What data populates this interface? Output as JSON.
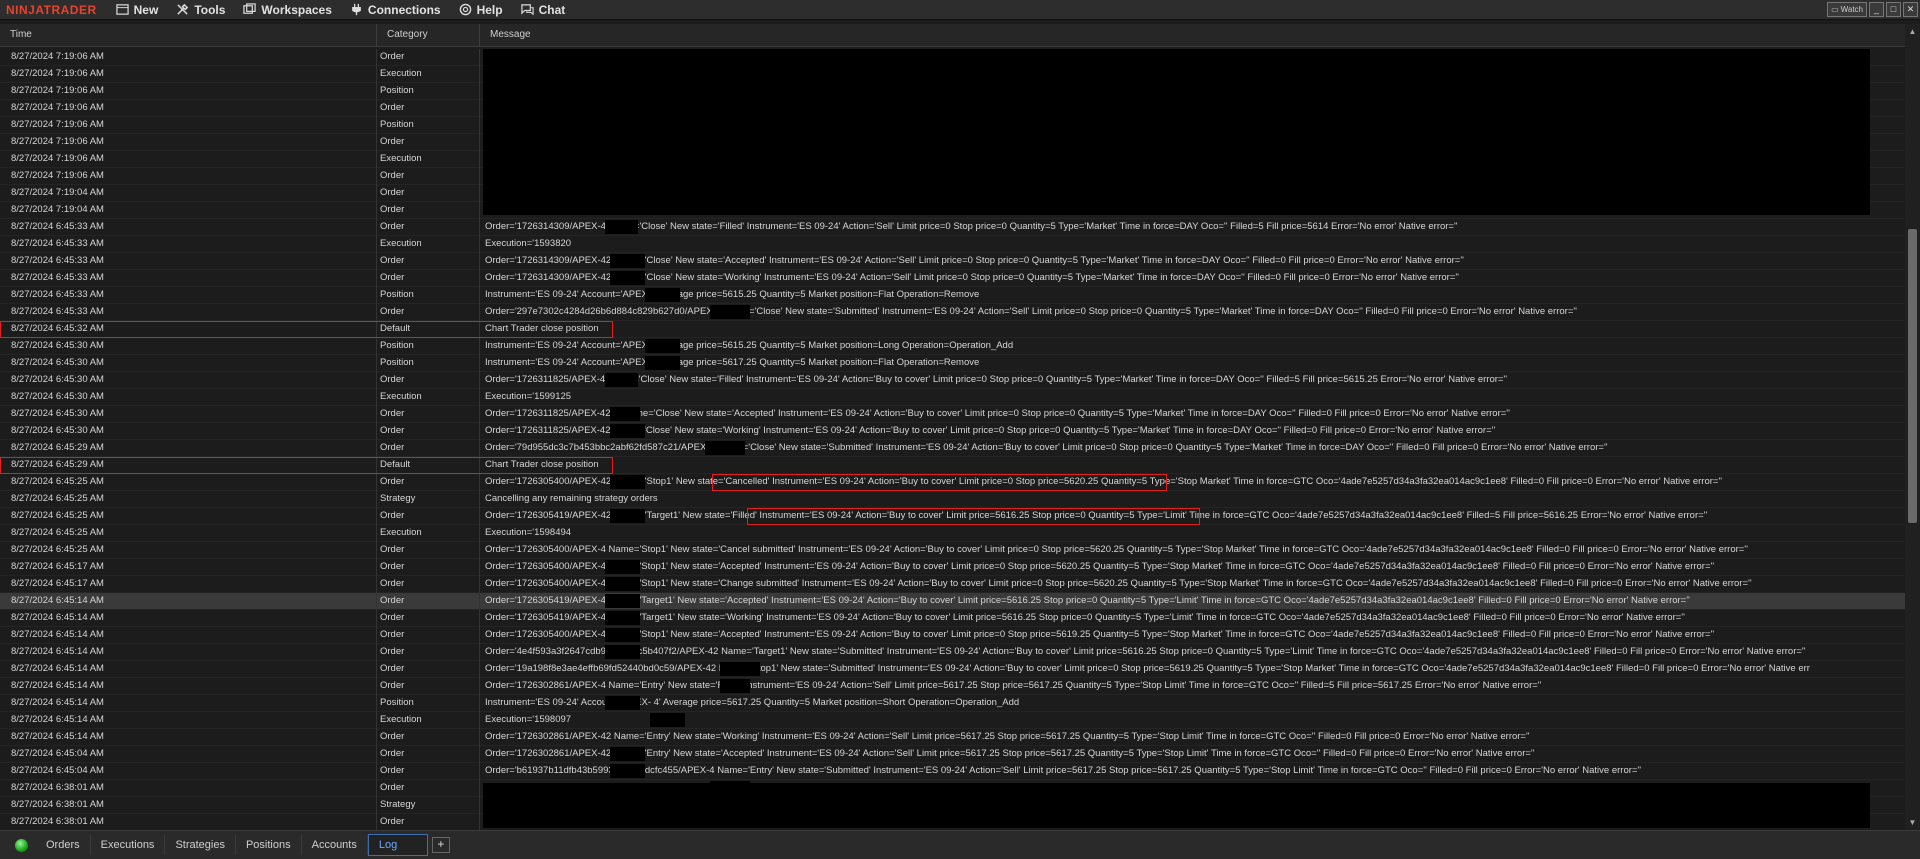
{
  "app": {
    "logo": "NINJATRADER"
  },
  "menu": [
    {
      "label": "New",
      "icon": "new-icon"
    },
    {
      "label": "Tools",
      "icon": "tools-icon"
    },
    {
      "label": "Workspaces",
      "icon": "workspaces-icon"
    },
    {
      "label": "Connections",
      "icon": "connections-icon"
    },
    {
      "label": "Help",
      "icon": "help-icon"
    },
    {
      "label": "Chat",
      "icon": "chat-icon"
    }
  ],
  "window": {
    "watch_label": "Watch"
  },
  "columns": {
    "time": "Time",
    "category": "Category",
    "message": "Message"
  },
  "rows": [
    {
      "time": "8/27/2024 7:19:06 AM",
      "category": "Order",
      "message": ""
    },
    {
      "time": "8/27/2024 7:19:06 AM",
      "category": "Execution",
      "message": ""
    },
    {
      "time": "8/27/2024 7:19:06 AM",
      "category": "Position",
      "message": ""
    },
    {
      "time": "8/27/2024 7:19:06 AM",
      "category": "Order",
      "message": ""
    },
    {
      "time": "8/27/2024 7:19:06 AM",
      "category": "Position",
      "message": ""
    },
    {
      "time": "8/27/2024 7:19:06 AM",
      "category": "Order",
      "message": ""
    },
    {
      "time": "8/27/2024 7:19:06 AM",
      "category": "Execution",
      "message": ""
    },
    {
      "time": "8/27/2024 7:19:06 AM",
      "category": "Order",
      "message": ""
    },
    {
      "time": "8/27/2024 7:19:04 AM",
      "category": "Order",
      "message": ""
    },
    {
      "time": "8/27/2024 7:19:04 AM",
      "category": "Order",
      "message": ""
    },
    {
      "time": "8/27/2024 6:45:33 AM",
      "category": "Order",
      "message": "Order='1726314309/APEX-4               Name='Close' New state='Filled' Instrument='ES 09-24' Action='Sell' Limit price=0 Stop price=0 Quantity=5 Type='Market' Time in force=DAY Oco='' Filled=5 Fill price=5614 Error='No error' Native error=''"
    },
    {
      "time": "8/27/2024 6:45:33 AM",
      "category": "Execution",
      "message": "Execution='1593820"
    },
    {
      "time": "8/27/2024 6:45:33 AM",
      "category": "Order",
      "message": "Order='1726314309/APEX-42              Name='Close' New state='Accepted' Instrument='ES 09-24' Action='Sell' Limit price=0 Stop price=0 Quantity=5 Type='Market' Time in force=DAY Oco='' Filled=0 Fill price=0 Error='No error' Native error=''"
    },
    {
      "time": "8/27/2024 6:45:33 AM",
      "category": "Order",
      "message": "Order='1726314309/APEX-42              Name='Close' New state='Working' Instrument='ES 09-24' Action='Sell' Limit price=0 Stop price=0 Quantity=5 Type='Market' Time in force=DAY Oco='' Filled=0 Fill price=0 Error='No error' Native error=''"
    },
    {
      "time": "8/27/2024 6:45:33 AM",
      "category": "Position",
      "message": "Instrument='ES 09-24' Account='APEX-4              Average price=5615.25 Quantity=5 Market position=Flat Operation=Remove"
    },
    {
      "time": "8/27/2024 6:45:33 AM",
      "category": "Order",
      "message": "Order='297e7302c4284d26b6d884c829b627d0/APEX-4              Name='Close' New state='Submitted' Instrument='ES 09-24' Action='Sell' Limit price=0 Stop price=0 Quantity=5 Type='Market' Time in force=DAY Oco='' Filled=0 Fill price=0 Error='No error' Native error=''"
    },
    {
      "time": "8/27/2024 6:45:32 AM",
      "category": "Default",
      "message": "Chart Trader close position"
    },
    {
      "time": "8/27/2024 6:45:30 AM",
      "category": "Position",
      "message": "Instrument='ES 09-24' Account='APEX-4              Average price=5615.25 Quantity=5 Market position=Long Operation=Operation_Add"
    },
    {
      "time": "8/27/2024 6:45:30 AM",
      "category": "Position",
      "message": "Instrument='ES 09-24' Account='APEX-4              Average price=5617.25 Quantity=5 Market position=Flat Operation=Remove"
    },
    {
      "time": "8/27/2024 6:45:30 AM",
      "category": "Order",
      "message": "Order='1726311825/APEX-4               Name='Close' New state='Filled' Instrument='ES 09-24' Action='Buy to cover' Limit price=0 Stop price=0 Quantity=5 Type='Market' Time in force=DAY Oco='' Filled=5 Fill price=5615.25 Error='No error' Native error=''"
    },
    {
      "time": "8/27/2024 6:45:30 AM",
      "category": "Execution",
      "message": "Execution='1599125"
    },
    {
      "time": "8/27/2024 6:45:30 AM",
      "category": "Order",
      "message": "Order='1726311825/APEX-42            4' Name='Close' New state='Accepted' Instrument='ES 09-24' Action='Buy to cover' Limit price=0 Stop price=0 Quantity=5 Type='Market' Time in force=DAY Oco='' Filled=0 Fill price=0 Error='No error' Native error=''"
    },
    {
      "time": "8/27/2024 6:45:30 AM",
      "category": "Order",
      "message": "Order='1726311825/APEX-42              Name='Close' New state='Working' Instrument='ES 09-24' Action='Buy to cover' Limit price=0 Stop price=0 Quantity=5 Type='Market' Time in force=DAY Oco='' Filled=0 Fill price=0 Error='No error' Native error=''"
    },
    {
      "time": "8/27/2024 6:45:29 AM",
      "category": "Order",
      "message": "Order='79d955dc3c7b453bbc2abf62fd587c21/APEX-4              Name='Close' New state='Submitted' Instrument='ES 09-24' Action='Buy to cover' Limit price=0 Stop price=0 Quantity=5 Type='Market' Time in force=DAY Oco='' Filled=0 Fill price=0 Error='No error' Native error=''"
    },
    {
      "time": "8/27/2024 6:45:29 AM",
      "category": "Default",
      "message": "Chart Trader close position"
    },
    {
      "time": "8/27/2024 6:45:25 AM",
      "category": "Order",
      "message": "Order='1726305400/APEX-42             Name='Stop1' New state='Cancelled' Instrument='ES 09-24' Action='Buy to cover' Limit price=0 Stop price=5620.25 Quantity=5 Type='Stop Market' Time in force=GTC Oco='4ade7e5257d34a3fa32ea014ac9c1ee8' Filled=0 Fill price=0 Error='No error' Native error=''"
    },
    {
      "time": "8/27/2024 6:45:25 AM",
      "category": "Strategy",
      "message": "Cancelling any remaining strategy orders"
    },
    {
      "time": "8/27/2024 6:45:25 AM",
      "category": "Order",
      "message": "Order='1726305419/APEX-42             Name='Target1' New state='Filled' Instrument='ES 09-24' Action='Buy to cover' Limit price=5616.25 Stop price=0 Quantity=5 Type='Limit' Time in force=GTC Oco='4ade7e5257d34a3fa32ea014ac9c1ee8' Filled=5 Fill price=5616.25 Error='No error' Native error=''"
    },
    {
      "time": "8/27/2024 6:45:25 AM",
      "category": "Execution",
      "message": "Execution='1598494"
    },
    {
      "time": "8/27/2024 6:45:25 AM",
      "category": "Order",
      "message": "Order='1726305400/APEX-4              Name='Stop1' New state='Cancel submitted' Instrument='ES 09-24' Action='Buy to cover' Limit price=0 Stop price=5620.25 Quantity=5 Type='Stop Market' Time in force=GTC Oco='4ade7e5257d34a3fa32ea014ac9c1ee8' Filled=0 Fill price=0 Error='No error' Native error=''"
    },
    {
      "time": "8/27/2024 6:45:17 AM",
      "category": "Order",
      "message": "Order='1726305400/APEX-4              Name='Stop1' New state='Accepted' Instrument='ES 09-24' Action='Buy to cover' Limit price=0 Stop price=5620.25 Quantity=5 Type='Stop Market' Time in force=GTC Oco='4ade7e5257d34a3fa32ea014ac9c1ee8' Filled=0 Fill price=0 Error='No error' Native error=''"
    },
    {
      "time": "8/27/2024 6:45:17 AM",
      "category": "Order",
      "message": "Order='1726305400/APEX-4              Name='Stop1' New state='Change submitted' Instrument='ES 09-24' Action='Buy to cover' Limit price=0 Stop price=5620.25 Quantity=5 Type='Stop Market' Time in force=GTC Oco='4ade7e5257d34a3fa32ea014ac9c1ee8' Filled=0 Fill price=0 Error='No error' Native error=''"
    },
    {
      "time": "8/27/2024 6:45:14 AM",
      "category": "Order",
      "message": "Order='1726305419/APEX-4              Name='Target1' New state='Accepted' Instrument='ES 09-24' Action='Buy to cover' Limit price=5616.25 Stop price=0 Quantity=5 Type='Limit' Time in force=GTC Oco='4ade7e5257d34a3fa32ea014ac9c1ee8' Filled=0 Fill price=0 Error='No error' Native error=''"
    },
    {
      "time": "8/27/2024 6:45:14 AM",
      "category": "Order",
      "message": "Order='1726305419/APEX-4              Name='Target1' New state='Working' Instrument='ES 09-24' Action='Buy to cover' Limit price=5616.25 Stop price=0 Quantity=5 Type='Limit' Time in force=GTC Oco='4ade7e5257d34a3fa32ea014ac9c1ee8' Filled=0 Fill price=0 Error='No error' Native error=''"
    },
    {
      "time": "8/27/2024 6:45:14 AM",
      "category": "Order",
      "message": "Order='1726305400/APEX-4              Name='Stop1' New state='Accepted' Instrument='ES 09-24' Action='Buy to cover' Limit price=0 Stop price=5619.25 Quantity=5 Type='Stop Market' Time in force=GTC Oco='4ade7e5257d34a3fa32ea014ac9c1ee8' Filled=0 Fill price=0 Error='No error' Native error=''"
    },
    {
      "time": "8/27/2024 6:45:14 AM",
      "category": "Order",
      "message": "Order='4e4f593a3f2647cdb9aed4e5c5b407f2/APEX-42            Name='Target1' New state='Submitted' Instrument='ES 09-24' Action='Buy to cover' Limit price=5616.25 Stop price=0 Quantity=5 Type='Limit' Time in force=GTC Oco='4ade7e5257d34a3fa32ea014ac9c1ee8' Filled=0 Fill price=0 Error='No error' Native error=''"
    },
    {
      "time": "8/27/2024 6:45:14 AM",
      "category": "Order",
      "message": "Order='19a198f8e3ae4effb69fd52440bd0c59/APEX-42            Name='Stop1' New state='Submitted' Instrument='ES 09-24' Action='Buy to cover' Limit price=0 Stop price=5619.25 Quantity=5 Type='Stop Market' Time in force=GTC Oco='4ade7e5257d34a3fa32ea014ac9c1ee8' Filled=0 Fill price=0 Error='No error' Native err"
    },
    {
      "time": "8/27/2024 6:45:14 AM",
      "category": "Order",
      "message": "Order='1726302861/APEX-4              Name='Entry' New state='Filled' Instrument='ES 09-24' Action='Sell' Limit price=5617.25 Stop price=5617.25 Quantity=5 Type='Stop Limit' Time in force=GTC Oco='' Filled=5 Fill price=5617.25 Error='No error' Native error=''"
    },
    {
      "time": "8/27/2024 6:45:14 AM",
      "category": "Position",
      "message": "Instrument='ES 09-24' Account='APEX-           4' Average price=5617.25 Quantity=5 Market position=Short Operation=Operation_Add"
    },
    {
      "time": "8/27/2024 6:45:14 AM",
      "category": "Execution",
      "message": "Execution='1598097"
    },
    {
      "time": "8/27/2024 6:45:14 AM",
      "category": "Order",
      "message": "Order='1726302861/APEX-42            Name='Entry' New state='Working' Instrument='ES 09-24' Action='Sell' Limit price=5617.25 Stop price=5617.25 Quantity=5 Type='Stop Limit' Time in force=GTC Oco='' Filled=0 Fill price=0 Error='No error' Native error=''"
    },
    {
      "time": "8/27/2024 6:45:04 AM",
      "category": "Order",
      "message": "Order='1726302861/APEX-42            Name='Entry' New state='Accepted' Instrument='ES 09-24' Action='Sell' Limit price=5617.25 Stop price=5617.25 Quantity=5 Type='Stop Limit' Time in force=GTC Oco='' Filled=0 Fill price=0 Error='No error' Native error=''"
    },
    {
      "time": "8/27/2024 6:45:04 AM",
      "category": "Order",
      "message": "Order='b61937b11dfb43b5993314ceadcfc455/APEX-4              Name='Entry' New state='Submitted' Instrument='ES 09-24' Action='Sell' Limit price=5617.25 Stop price=5617.25 Quantity=5 Type='Stop Limit' Time in force=GTC Oco='' Filled=0 Fill price=0 Error='No error' Native error=''"
    },
    {
      "time": "8/27/2024 6:38:01 AM",
      "category": "Order",
      "message": ""
    },
    {
      "time": "8/27/2024 6:38:01 AM",
      "category": "Strategy",
      "message": ""
    },
    {
      "time": "8/27/2024 6:38:01 AM",
      "category": "Order",
      "message": ""
    }
  ],
  "tabs": [
    {
      "label": "Orders"
    },
    {
      "label": "Executions"
    },
    {
      "label": "Strategies"
    },
    {
      "label": "Positions"
    },
    {
      "label": "Accounts"
    },
    {
      "label": "Log",
      "active": true
    }
  ],
  "tab_add_label": "+",
  "colors": {
    "highlight": "#e01e1e",
    "accent": "#3d6fb0",
    "logo": "#e8432c"
  }
}
